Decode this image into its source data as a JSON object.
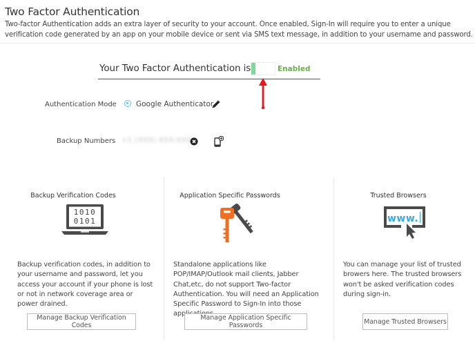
{
  "header": {
    "title": "Two Factor Authentication",
    "description": "Two-factor Authentication adds an extra layer of security to your account. Once enabled, Sign-In will require you to enter a unique verification code generated by an app on your mobile device or sent via SMS text message, in addition to your username and password."
  },
  "status": {
    "text": "Your Two Factor Authentication is",
    "toggle_state": "on",
    "toggle_label": "Enabled",
    "toggle_color": "#7fd99a",
    "label_color": "#6ab04c",
    "annotation": "red-up-arrow"
  },
  "auth_mode": {
    "label": "Authentication Mode",
    "value": "Google Authenticator",
    "radio_color": "#5bc8e8",
    "icon": "pencil-icon"
  },
  "backup_numbers": {
    "label": "Backup Numbers",
    "value": "+1 (XXX) XXX-XXXX",
    "remove_icon": "close-circle-icon",
    "add_icon": "add-phone-icon"
  },
  "sections": [
    {
      "title": "Backup Verification Codes",
      "icon": "laptop-binary-icon",
      "icon_text_line1": "1010",
      "icon_text_line2": "0101",
      "description": "Backup verification codes, in addition to your username and password, let you access your account if your phone is lost or not in network coverage area or power drained.",
      "button": "Manage Backup Verification Codes"
    },
    {
      "title": "Application Specific Passwords",
      "icon": "keys-icon",
      "icon_color": "#f26f21",
      "description": "Standalone applications like POP/IMAP/Outlook mail clients, Jabber Chat,etc, do not support Two-factor Authentication. You will need an Application Specific Password to Sign-In into those applications.",
      "button": "Manage Application Specific Passwords"
    },
    {
      "title": "Trusted Browsers",
      "icon": "browser-www-icon",
      "icon_text": "www.",
      "icon_color": "#3aa8e0",
      "description": "You can manage your list of trusted browers here. The trusted browsers won't be asked verification codes during sign-in.",
      "button": "Manage Trusted Browsers"
    }
  ]
}
